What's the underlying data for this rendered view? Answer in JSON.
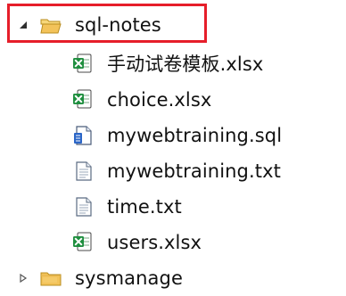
{
  "tree": {
    "root": {
      "label": "sql-notes",
      "expanded": true,
      "children": [
        {
          "label": "手动试卷模板.xlsx",
          "type": "excel-file"
        },
        {
          "label": "choice.xlsx",
          "type": "excel-file"
        },
        {
          "label": "mywebtraining.sql",
          "type": "sql-file"
        },
        {
          "label": "mywebtraining.txt",
          "type": "text-file"
        },
        {
          "label": "time.txt",
          "type": "text-file"
        },
        {
          "label": "users.xlsx",
          "type": "excel-file"
        }
      ]
    },
    "sibling": {
      "label": "sysmanage",
      "expanded": false
    }
  },
  "colors": {
    "selection_border": "#e61e2a",
    "folder": "#f3c35a",
    "excel": "#1f8f3f"
  }
}
